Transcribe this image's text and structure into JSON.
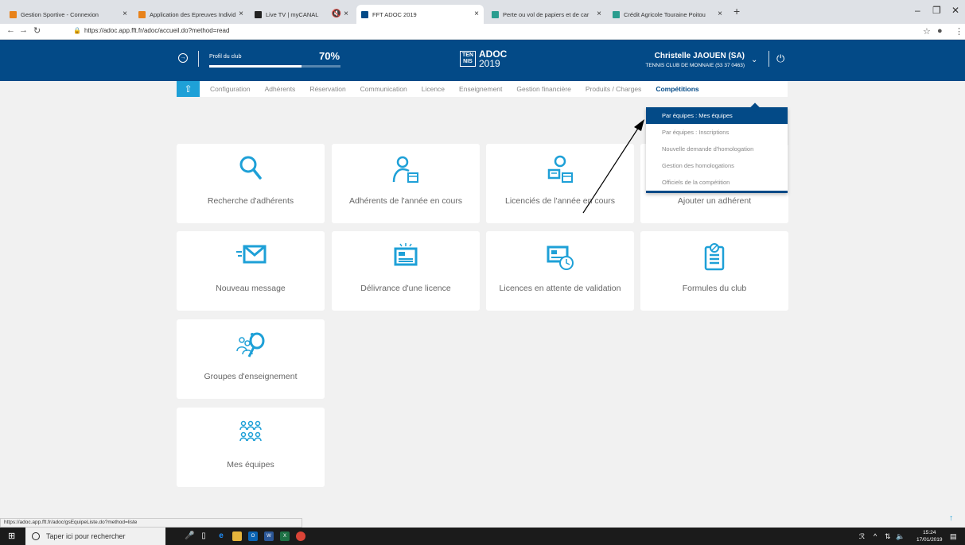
{
  "browser": {
    "tabs": [
      {
        "title": "Gestion Sportive - Connexion",
        "color": "#e8821a"
      },
      {
        "title": "Application des Epreuves Individ",
        "color": "#e8821a"
      },
      {
        "title": "Live TV | myCANAL",
        "color": "#222222"
      },
      {
        "title": "FFT ADOC 2019",
        "color": "#034a87"
      },
      {
        "title": "Perte ou vol de papiers et de car",
        "color": "#2a9d8f"
      },
      {
        "title": "Crédit Agricole Touraine Poitou",
        "color": "#2a9d8f"
      }
    ],
    "url": "https://adoc.app.fft.fr/adoc/accueil.do?method=read",
    "status_url": "https://adoc.app.fft.fr/adoc/gsEquipeListe.do?method=liste"
  },
  "header": {
    "profil_label": "Profil du club",
    "profil_pct": "70%",
    "profil_fraction": 0.7,
    "logo_box": "TEN NIS",
    "logo_title": "ADOC",
    "logo_year": "2019",
    "user_name": "Christelle JAOUEN (SA)",
    "user_club": "TENNIS CLUB DE MONNAIE (53 37 0463)"
  },
  "menu": {
    "items": [
      {
        "label": "Configuration"
      },
      {
        "label": "Adhérents"
      },
      {
        "label": "Réservation"
      },
      {
        "label": "Communication"
      },
      {
        "label": "Licence"
      },
      {
        "label": "Enseignement"
      },
      {
        "label": "Gestion financière"
      },
      {
        "label": "Produits / Charges"
      },
      {
        "label": "Compétitions"
      }
    ]
  },
  "dropdown": {
    "items": [
      {
        "label": "Par équipes : Mes équipes"
      },
      {
        "label": "Par équipes : Inscriptions"
      },
      {
        "label": "Nouvelle demande d'homologation"
      },
      {
        "label": "Gestion des homologations"
      },
      {
        "label": "Officiels de la compétition"
      }
    ]
  },
  "tiles": [
    {
      "label": "Recherche d'adhérents",
      "icon": "search-icon"
    },
    {
      "label": "Adhérents de l'année en cours",
      "icon": "member-calendar-icon"
    },
    {
      "label": "Licenciés de l'année en cours",
      "icon": "licence-member-icon"
    },
    {
      "label": "Ajouter un adhérent",
      "icon": "add-member-icon"
    },
    {
      "label": "Nouveau message",
      "icon": "envelope-icon"
    },
    {
      "label": "Délivrance d'une licence",
      "icon": "licence-card-icon"
    },
    {
      "label": "Licences en attente de validation",
      "icon": "licence-clock-icon"
    },
    {
      "label": "Formules du club",
      "icon": "clipboard-icon"
    },
    {
      "label": "Groupes d'enseignement",
      "icon": "racket-group-icon"
    },
    {
      "label": "Mes équipes",
      "icon": "team-icon"
    }
  ],
  "taskbar": {
    "search_placeholder": "Taper ici pour rechercher",
    "time": "15:24",
    "date": "17/01/2019"
  },
  "colors": {
    "brand": "#034a87",
    "accent": "#1ea0d7"
  }
}
